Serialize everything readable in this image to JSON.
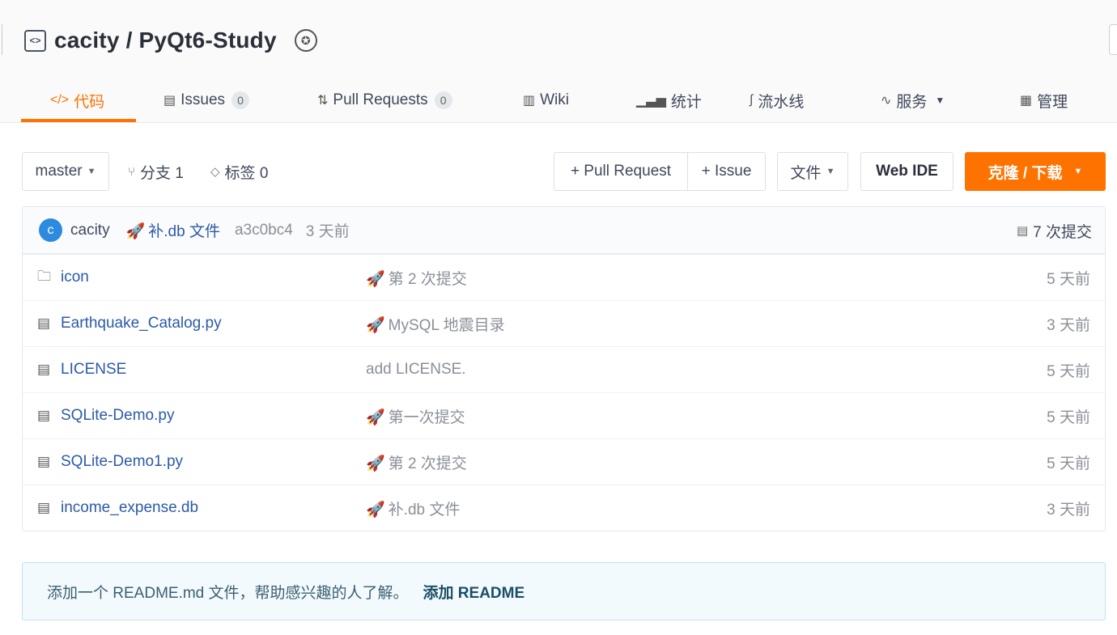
{
  "repo": {
    "title": "cacity / PyQt6-Study"
  },
  "tabs": [
    {
      "label": "代码"
    },
    {
      "label": "Issues",
      "count": "0"
    },
    {
      "label": "Pull Requests",
      "count": "0"
    },
    {
      "label": "Wiki"
    },
    {
      "label": "统计"
    },
    {
      "label": "流水线"
    },
    {
      "label": "服务"
    },
    {
      "label": "管理"
    }
  ],
  "toolbar": {
    "branch": "master",
    "branches": "分支 1",
    "tags": "标签 0",
    "pull_request": "+ Pull Request",
    "issue": "+ Issue",
    "file": "文件",
    "web_ide": "Web IDE",
    "clone": "克隆 / 下载"
  },
  "latest_commit": {
    "avatar_letter": "c",
    "user": "cacity",
    "message": "补.db 文件",
    "hash": "a3c0bc4",
    "time": "3 天前",
    "commits": "7 次提交"
  },
  "files": [
    {
      "icon": "folder-icon",
      "name": "icon",
      "message": "第 2 次提交",
      "rocket": true,
      "time": "5 天前"
    },
    {
      "icon": "file-icon",
      "name": "Earthquake_Catalog.py",
      "message": "MySQL 地震目录",
      "rocket": true,
      "time": "3 天前"
    },
    {
      "icon": "file-icon",
      "name": "LICENSE",
      "message": "add LICENSE.",
      "rocket": false,
      "time": "5 天前"
    },
    {
      "icon": "file-icon",
      "name": "SQLite-Demo.py",
      "message": "第一次提交",
      "rocket": true,
      "time": "5 天前"
    },
    {
      "icon": "file-icon",
      "name": "SQLite-Demo1.py",
      "message": "第 2 次提交",
      "rocket": true,
      "time": "5 天前"
    },
    {
      "icon": "file-icon",
      "name": "income_expense.db",
      "message": "补.db 文件",
      "rocket": true,
      "time": "3 天前"
    }
  ],
  "readme": {
    "text": "添加一个 README.md 文件，帮助感兴趣的人了解。",
    "link": "添加 README"
  },
  "colors": {
    "accent": "#fe7300",
    "link": "#2b5aa8",
    "muted": "#8a8f99"
  }
}
